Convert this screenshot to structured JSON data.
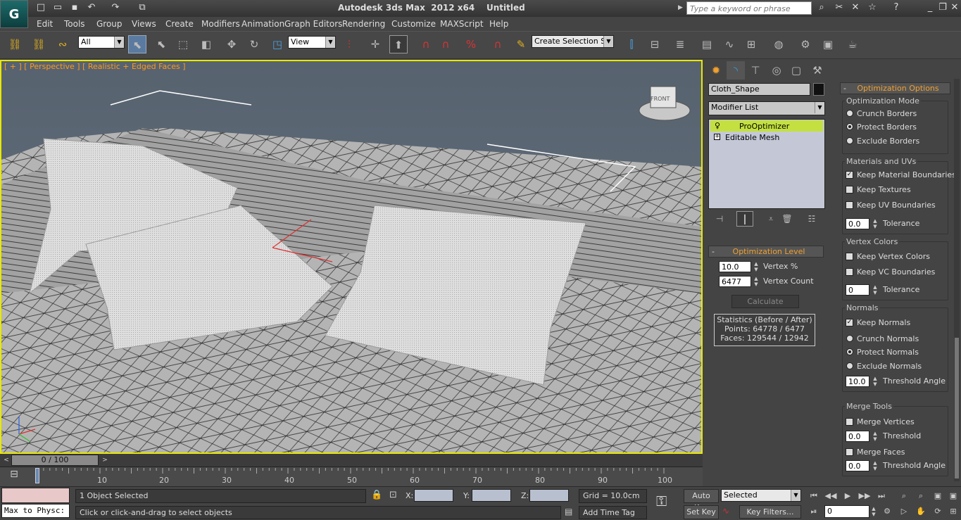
{
  "window": {
    "title": "Autodesk 3ds Max  2012 x64    Untitled",
    "logo": "G",
    "search_placeholder": "Type a keyword or phrase",
    "quick_access_icons": [
      "new-icon",
      "open-icon",
      "save-icon",
      "undo-icon",
      "redo-icon",
      "project-icon"
    ],
    "help_icons": [
      "binoculars-icon",
      "tools-icon",
      "exchange-icon",
      "star-icon",
      "help-icon"
    ],
    "window_icons": [
      "minimize-icon",
      "restore-icon",
      "close-icon"
    ]
  },
  "menu": [
    "Edit",
    "Tools",
    "Group",
    "Views",
    "Create",
    "Modifiers",
    "Animation",
    "Graph Editors",
    "Rendering",
    "Customize",
    "MAXScript",
    "Help"
  ],
  "toolbar": {
    "selection_filter": "All",
    "reference_coord": "View",
    "named_selection": "Create Selection Se"
  },
  "viewport": {
    "label": "[ + ] [ Perspective ] [ Realistic + Edged Faces ]",
    "viewcube_label": "FRONT"
  },
  "command_panel": {
    "tab_icons": [
      "create-icon",
      "modify-icon",
      "hierarchy-icon",
      "motion-icon",
      "display-icon",
      "utilities-icon"
    ],
    "object_name": "Cloth_Shape",
    "modifier_list": "Modifier List",
    "stack": [
      {
        "label": "ProOptimizer",
        "active": true
      },
      {
        "label": "Editable Mesh",
        "active": false
      }
    ],
    "stack_button_icons": [
      "pin-stack-icon",
      "show-end-result-icon",
      "make-unique-icon",
      "remove-modifier-icon",
      "configure-sets-icon"
    ],
    "optimization_level": {
      "title": "Optimization Level",
      "vertex_percent_value": "10.0",
      "vertex_percent_label": "Vertex %",
      "vertex_count_value": "6477",
      "vertex_count_label": "Vertex Count",
      "calculate_label": "Calculate",
      "stats_title": "Statistics (Before / After)",
      "stats_points": "Points: 64778 / 6477",
      "stats_faces": "Faces: 129544 / 12942"
    }
  },
  "options_panel": {
    "title": "Optimization Options",
    "mode_group": "Optimization Mode",
    "modes": [
      {
        "label": "Crunch Borders",
        "checked": false
      },
      {
        "label": "Protect Borders",
        "checked": true
      },
      {
        "label": "Exclude Borders",
        "checked": false
      }
    ],
    "materials_group": "Materials and UVs",
    "materials": [
      {
        "label": "Keep Material Boundaries",
        "checked": true
      },
      {
        "label": "Keep Textures",
        "checked": false
      },
      {
        "label": "Keep UV Boundaries",
        "checked": false
      }
    ],
    "materials_tolerance": "0.0",
    "tolerance_label": "Tolerance",
    "vertex_colors_group": "Vertex Colors",
    "vertex_colors": [
      {
        "label": "Keep Vertex Colors",
        "checked": false
      },
      {
        "label": "Keep VC Boundaries",
        "checked": false
      }
    ],
    "vc_tolerance": "0",
    "normals_group": "Normals",
    "keep_normals": {
      "label": "Keep Normals",
      "checked": true
    },
    "normal_modes": [
      {
        "label": "Crunch Normals",
        "checked": false
      },
      {
        "label": "Protect Normals",
        "checked": true
      },
      {
        "label": "Exclude Normals",
        "checked": false
      }
    ],
    "threshold_angle_value": "10.0",
    "threshold_angle_label": "Threshold Angle",
    "merge_group": "Merge Tools",
    "merge_vertices": {
      "label": "Merge Vertices",
      "checked": false
    },
    "merge_vertices_threshold": "0.0",
    "threshold_label": "Threshold",
    "merge_faces": {
      "label": "Merge Faces",
      "checked": false
    },
    "merge_faces_angle": "0.0"
  },
  "timeline": {
    "frame_display": "0 / 100",
    "ticks": [
      "10",
      "20",
      "30",
      "40",
      "50",
      "60",
      "70",
      "80",
      "90",
      "100"
    ]
  },
  "status": {
    "maxscript_listener": "Max to Physc:",
    "selection_count": "1 Object Selected",
    "prompt": "Click or click-and-drag to select objects",
    "x_label": "X:",
    "y_label": "Y:",
    "z_label": "Z:",
    "grid": "Grid = 10.0cm",
    "add_time_tag": "Add Time Tag",
    "auto_key": "Auto Key",
    "set_key": "Set Key",
    "key_mode": "Selected",
    "key_filters": "Key Filters...",
    "current_frame": "0"
  }
}
